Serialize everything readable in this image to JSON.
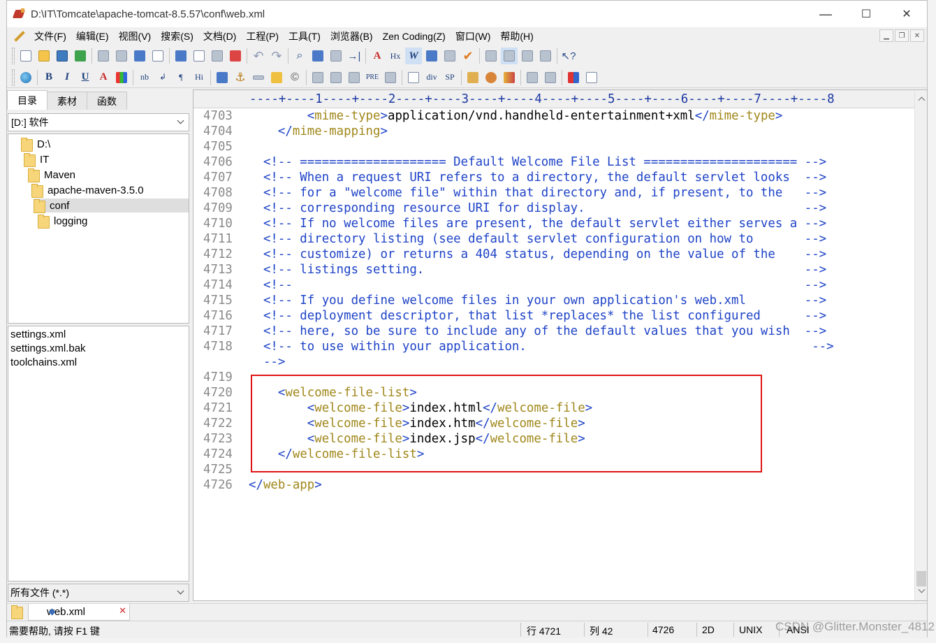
{
  "window": {
    "title": "D:\\IT\\Tomcate\\apache-tomcat-8.5.57\\conf\\web.xml",
    "controls": {
      "minimize": "—",
      "maximize": "☐",
      "close": "✕"
    }
  },
  "menu": [
    "文件(F)",
    "编辑(E)",
    "视图(V)",
    "搜索(S)",
    "文档(D)",
    "工程(P)",
    "工具(T)",
    "浏览器(B)",
    "Zen Coding(Z)",
    "窗口(W)",
    "帮助(H)"
  ],
  "toolbar2_text": {
    "bold": "B",
    "italic": "I",
    "underline": "U",
    "color": "A",
    "nb": "nb",
    "enter": "↲",
    "para": "¶",
    "hi": "Hi",
    "div": "div",
    "sp": "SP",
    "pre": "PRE",
    "hx": "Hx",
    "w": "W"
  },
  "sidebar": {
    "tabs": [
      "目录",
      "素材",
      "函数"
    ],
    "drive": "[D:] 软件",
    "tree": [
      "D:\\",
      "IT",
      "Maven",
      "apache-maven-3.5.0",
      "conf",
      "logging"
    ],
    "selected_tree": "conf",
    "files": [
      "settings.xml",
      "settings.xml.bak",
      "toolchains.xml"
    ],
    "filter": "所有文件 (*.*)"
  },
  "editor": {
    "ruler": "----+----1----+----2----+----3----+----4----+----5----+----6----+----7----+----8",
    "lines": [
      {
        "n": "4703",
        "parts": [
          [
            "",
            "        "
          ],
          [
            "brk",
            "<"
          ],
          [
            "tag",
            "mime-type"
          ],
          [
            "brk",
            ">"
          ],
          [
            "",
            "application/vnd.handheld-entertainment+xml"
          ],
          [
            "brk",
            "</"
          ],
          [
            "tag",
            "mime-type"
          ],
          [
            "brk",
            ">"
          ]
        ]
      },
      {
        "n": "4704",
        "parts": [
          [
            "",
            "    "
          ],
          [
            "brk",
            "</"
          ],
          [
            "tag",
            "mime-mapping"
          ],
          [
            "brk",
            ">"
          ]
        ]
      },
      {
        "n": "4705",
        "parts": []
      },
      {
        "n": "4706",
        "parts": [
          [
            "cmt",
            "  <!-- ==================== Default Welcome File List ===================== -->"
          ]
        ]
      },
      {
        "n": "4707",
        "parts": [
          [
            "cmt",
            "  <!-- When a request URI refers to a directory, the default servlet looks  -->"
          ]
        ]
      },
      {
        "n": "4708",
        "parts": [
          [
            "cmt",
            "  <!-- for a \"welcome file\" within that directory and, if present, to the   -->"
          ]
        ]
      },
      {
        "n": "4709",
        "parts": [
          [
            "cmt",
            "  <!-- corresponding resource URI for display.                              -->"
          ]
        ]
      },
      {
        "n": "4710",
        "parts": [
          [
            "cmt",
            "  <!-- If no welcome files are present, the default servlet either serves a -->"
          ]
        ]
      },
      {
        "n": "4711",
        "parts": [
          [
            "cmt",
            "  <!-- directory listing (see default servlet configuration on how to       -->"
          ]
        ]
      },
      {
        "n": "4712",
        "parts": [
          [
            "cmt",
            "  <!-- customize) or returns a 404 status, depending on the value of the    -->"
          ]
        ]
      },
      {
        "n": "4713",
        "parts": [
          [
            "cmt",
            "  <!-- listings setting.                                                    -->"
          ]
        ]
      },
      {
        "n": "4714",
        "parts": [
          [
            "cmt",
            "  <!--                                                                      -->"
          ]
        ]
      },
      {
        "n": "4715",
        "parts": [
          [
            "cmt",
            "  <!-- If you define welcome files in your own application's web.xml        -->"
          ]
        ]
      },
      {
        "n": "4716",
        "parts": [
          [
            "cmt",
            "  <!-- deployment descriptor, that list *replaces* the list configured      -->"
          ]
        ]
      },
      {
        "n": "4717",
        "parts": [
          [
            "cmt",
            "  <!-- here, so be sure to include any of the default values that you wish  -->"
          ]
        ]
      },
      {
        "n": "4718",
        "parts": [
          [
            "cmt",
            "  <!-- to use within your application.                                       -->"
          ]
        ]
      },
      {
        "n": "",
        "parts": [
          [
            "cmt",
            "  -->"
          ]
        ]
      },
      {
        "n": "4719",
        "parts": []
      },
      {
        "n": "4720",
        "parts": [
          [
            "",
            "    "
          ],
          [
            "brk",
            "<"
          ],
          [
            "tag",
            "welcome-file-list"
          ],
          [
            "brk",
            ">"
          ]
        ]
      },
      {
        "n": "4721",
        "parts": [
          [
            "",
            "        "
          ],
          [
            "brk",
            "<"
          ],
          [
            "tag",
            "welcome-file"
          ],
          [
            "brk",
            ">"
          ],
          [
            "",
            "index.html"
          ],
          [
            "brk",
            "</"
          ],
          [
            "tag",
            "welcome-file"
          ],
          [
            "brk",
            ">"
          ]
        ]
      },
      {
        "n": "4722",
        "parts": [
          [
            "",
            "        "
          ],
          [
            "brk",
            "<"
          ],
          [
            "tag",
            "welcome-file"
          ],
          [
            "brk",
            ">"
          ],
          [
            "",
            "index.htm"
          ],
          [
            "brk",
            "</"
          ],
          [
            "tag",
            "welcome-file"
          ],
          [
            "brk",
            ">"
          ]
        ]
      },
      {
        "n": "4723",
        "parts": [
          [
            "",
            "        "
          ],
          [
            "brk",
            "<"
          ],
          [
            "tag",
            "welcome-file"
          ],
          [
            "brk",
            ">"
          ],
          [
            "",
            "index.jsp"
          ],
          [
            "brk",
            "</"
          ],
          [
            "tag",
            "welcome-file"
          ],
          [
            "brk",
            ">"
          ]
        ]
      },
      {
        "n": "4724",
        "parts": [
          [
            "",
            "    "
          ],
          [
            "brk",
            "</"
          ],
          [
            "tag",
            "welcome-file-list"
          ],
          [
            "brk",
            ">"
          ]
        ]
      },
      {
        "n": "4725",
        "parts": []
      },
      {
        "n": "4726",
        "parts": [
          [
            "brk",
            "</"
          ],
          [
            "tag",
            "web-app"
          ],
          [
            "brk",
            ">"
          ]
        ]
      }
    ]
  },
  "doc_tab": {
    "name": "web.xml",
    "close": "✕"
  },
  "status": {
    "help": "需要帮助, 请按 F1 键",
    "line": "行 4721",
    "col": "列 42",
    "total": "4726",
    "mode": "2D",
    "eol": "UNIX",
    "encoding": "ANSI"
  },
  "watermark": "CSDN @Glitter.Monster_4812",
  "colors": {
    "tag": "#a0871a",
    "bracket": "#1e43c7",
    "comment": "#1e43c7",
    "highlight": "#e01414"
  }
}
